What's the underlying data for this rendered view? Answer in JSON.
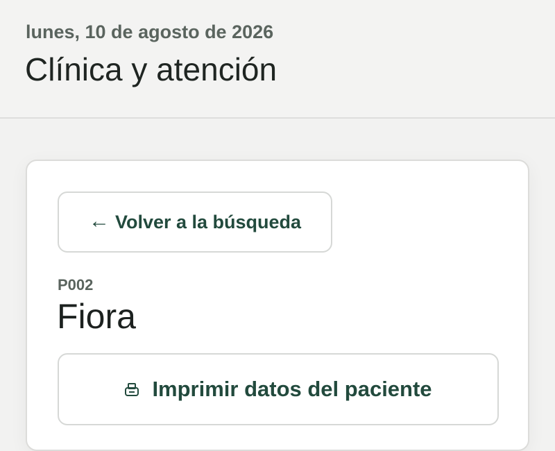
{
  "header": {
    "date": "lunes, 10 de agosto de 2026",
    "title": "Clínica y atención"
  },
  "card": {
    "back_button": {
      "icon": "arrow-left-icon",
      "arrow": "←",
      "label": "Volver a la búsqueda"
    },
    "patient": {
      "id": "P002",
      "name": "Fiora"
    },
    "print_button": {
      "icon": "printer-icon",
      "label": "Imprimir datos del paciente"
    }
  },
  "colors": {
    "accent": "#224a3d",
    "muted_text": "#5a645e",
    "page_background": "#f2f2f1",
    "card_background": "#ffffff",
    "border": "#d6d8d6"
  }
}
